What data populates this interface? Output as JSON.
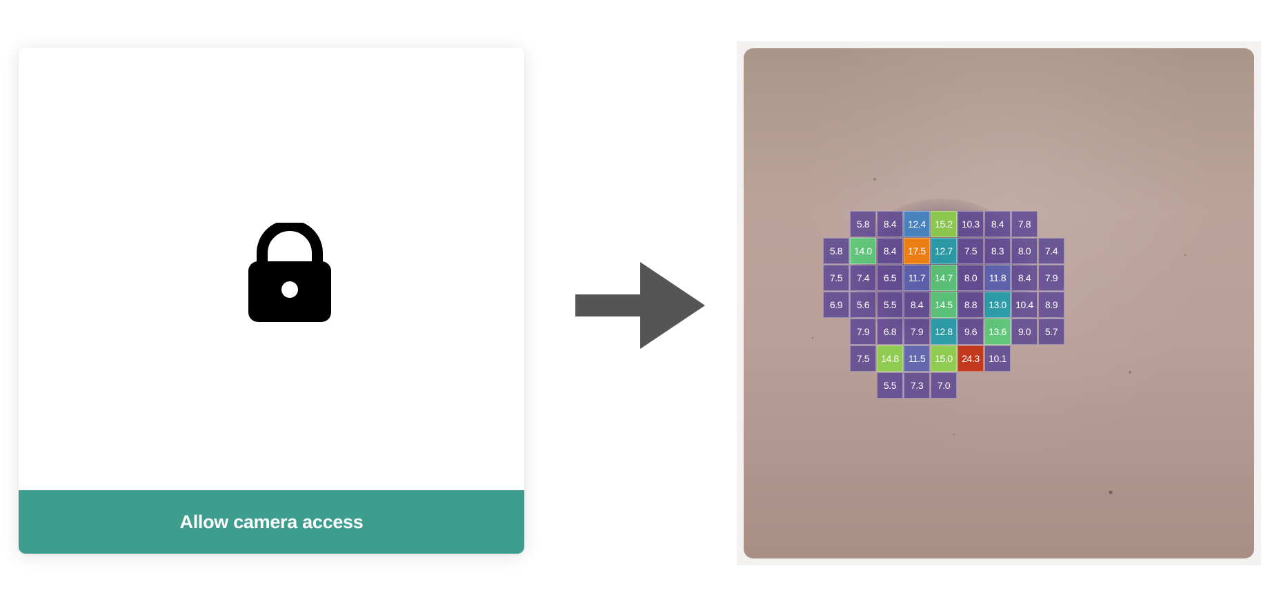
{
  "permission_card": {
    "button_label": "Allow camera access",
    "lock_icon": "lock-icon",
    "button_color": "#3d9d8f"
  },
  "arrow": {
    "icon": "arrow-right-icon",
    "color": "#555555"
  },
  "camera_preview": {
    "heatmap": {
      "rows": [
        [
          "",
          "5.8",
          "8.4",
          "12.4",
          "15.2",
          "10.3",
          "8.4",
          "7.8",
          ""
        ],
        [
          "5.8",
          "14.0",
          "8.4",
          "17.5",
          "12.7",
          "7.5",
          "8.3",
          "8.0",
          "7.4"
        ],
        [
          "7.5",
          "7.4",
          "6.5",
          "11.7",
          "14.7",
          "8.0",
          "11.8",
          "8.4",
          "7.9"
        ],
        [
          "6.9",
          "5.6",
          "5.5",
          "8.4",
          "14.5",
          "8.8",
          "13.0",
          "10.4",
          "8.9"
        ],
        [
          "",
          "7.9",
          "6.8",
          "7.9",
          "12.8",
          "9.6",
          "13.6",
          "9.0",
          "5.7"
        ],
        [
          "",
          "7.5",
          "14.8",
          "11.5",
          "15.0",
          "24.3",
          "10.1",
          "",
          ""
        ],
        [
          "",
          "",
          "5.5",
          "7.3",
          "7.0",
          "",
          "",
          "",
          ""
        ]
      ]
    }
  }
}
